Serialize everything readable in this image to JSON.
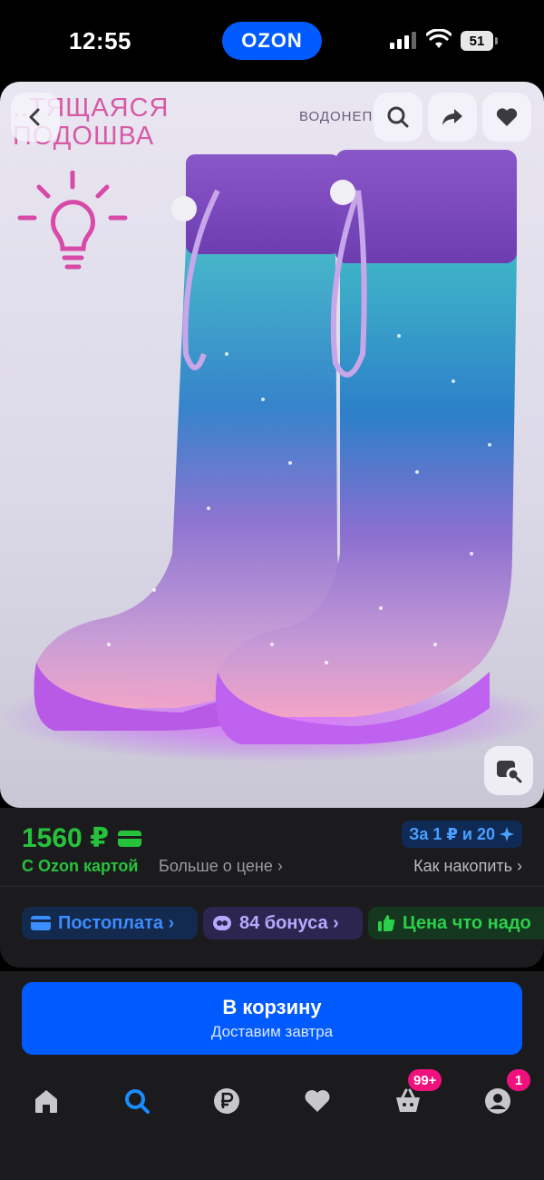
{
  "status_bar": {
    "time": "12:55",
    "app_pill": "OZON",
    "battery": "51"
  },
  "product_image": {
    "promo_left": "...ТЯЩАЯСЯ\nПОДОШВА",
    "promo_right": "ВОДОНЕП...",
    "icons": [
      "back-icon",
      "search-icon",
      "share-icon",
      "heart-icon",
      "similar-search-icon"
    ]
  },
  "price": {
    "amount": "1560 ₽",
    "ozon_card": "С Ozon картой",
    "more_about_price": "Больше о цене ›",
    "points_label": "За 1 ₽ и 20",
    "accumulate": "Как накопить ›",
    "colors": {
      "price_green": "#27c23c",
      "points_blue": "#4aa0ff"
    }
  },
  "chips": [
    {
      "label": "Постоплата ›",
      "icon": "card-icon"
    },
    {
      "label": "84 бонуса ›",
      "icon": "bonus-icon"
    },
    {
      "label": "Цена что надо",
      "icon": "thumb-up-icon"
    }
  ],
  "cart": {
    "button_label": "В корзину",
    "delivery": "Доставим завтра",
    "accent": "#005bff"
  },
  "tabbar": {
    "items": [
      {
        "name": "home",
        "icon": "home-icon"
      },
      {
        "name": "search",
        "icon": "search-icon",
        "active": true
      },
      {
        "name": "finance",
        "icon": "ruble-icon"
      },
      {
        "name": "favorites",
        "icon": "heart-icon"
      },
      {
        "name": "cart",
        "icon": "cart-icon",
        "badge": "99+"
      },
      {
        "name": "profile",
        "icon": "profile-icon",
        "badge": "1"
      }
    ]
  }
}
